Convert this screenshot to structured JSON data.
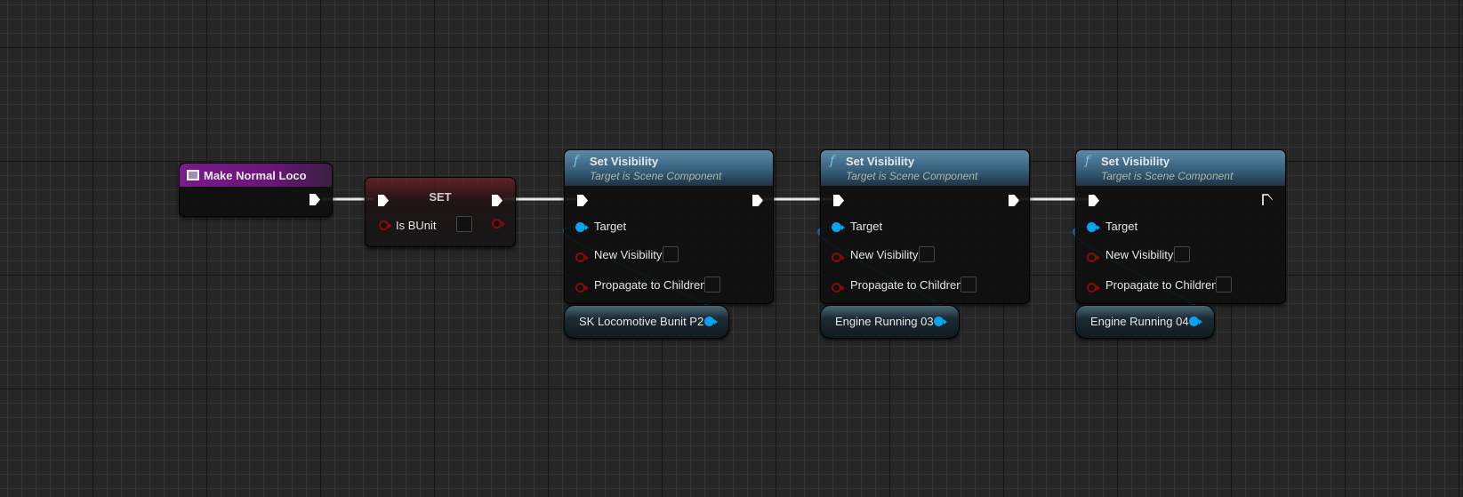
{
  "nodes": {
    "event": {
      "title": "Make Normal Loco"
    },
    "set": {
      "title": "SET",
      "pin_label": "Is BUnit",
      "value": false
    },
    "set_visibility": [
      {
        "title": "Set Visibility",
        "subtitle": "Target is Scene Component",
        "pins": [
          "Target",
          "New Visibility",
          "Propagate to Children"
        ],
        "new_visibility": false,
        "propagate": false,
        "target_var": "SK Locomotive Bunit P2"
      },
      {
        "title": "Set Visibility",
        "subtitle": "Target is Scene Component",
        "pins": [
          "Target",
          "New Visibility",
          "Propagate to Children"
        ],
        "new_visibility": false,
        "propagate": false,
        "target_var": "Engine Running 03"
      },
      {
        "title": "Set Visibility",
        "subtitle": "Target is Scene Component",
        "pins": [
          "Target",
          "New Visibility",
          "Propagate to Children"
        ],
        "new_visibility": false,
        "propagate": false,
        "target_var": "Engine Running 04"
      }
    ]
  },
  "icons": {
    "function": "f",
    "event": "event-icon"
  },
  "colors": {
    "exec_wire": "#ffffff",
    "object_pin": "#0aa2ee",
    "bool_pin": "#8a0a0a",
    "event_header": "#7a1a8c",
    "function_header": "#3a6480"
  }
}
